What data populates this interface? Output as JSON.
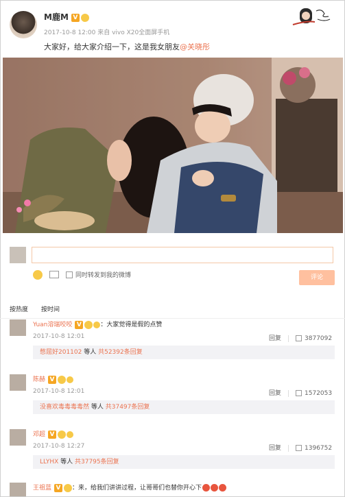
{
  "post": {
    "author": "M鹿M",
    "meta": "2017-10-8 12:00 来自 vivo X20全面屏手机",
    "text": "大家好，给大家介绍一下，这是我女朋友",
    "mention": "@关晓彤"
  },
  "composer": {
    "repost_label": "同时转发到我的微博",
    "submit_label": "评论"
  },
  "sort": {
    "hot": "按热度",
    "time": "按时间"
  },
  "comments": [
    {
      "name": "Yuan溶瑞咬咬",
      "text": "：大家觉得是假的点赞",
      "time": "2017-10-8 12:01",
      "reply": "回复",
      "likes": "3877092",
      "reply_user": "憋屈好201102",
      "reply_mid": " 等人 ",
      "reply_count": "共52392条回复"
    },
    {
      "name": "陈赫",
      "text": "",
      "time": "2017-10-8 12:01",
      "reply": "回复",
      "likes": "1572053",
      "reply_user": "没喜欢毒毒毒毒然",
      "reply_mid": " 等人 ",
      "reply_count": "共37497条回复"
    },
    {
      "name": "邓超",
      "text": "",
      "time": "2017-10-8 12:27",
      "reply": "回复",
      "likes": "1396752",
      "reply_user": "LLYHX",
      "reply_mid": " 等人 ",
      "reply_count": "共37795条回复"
    },
    {
      "name": "王祖蓝",
      "text": "：来，给我们讲讲过程，让哥哥们也替你开心下",
      "time": "",
      "reply": "",
      "likes": "",
      "reply_user": "",
      "reply_mid": "",
      "reply_count": ""
    }
  ],
  "colors": {
    "accent": "#eb7350",
    "submit_disabled": "#ffc09f",
    "input_border": "#f4c7a6"
  }
}
